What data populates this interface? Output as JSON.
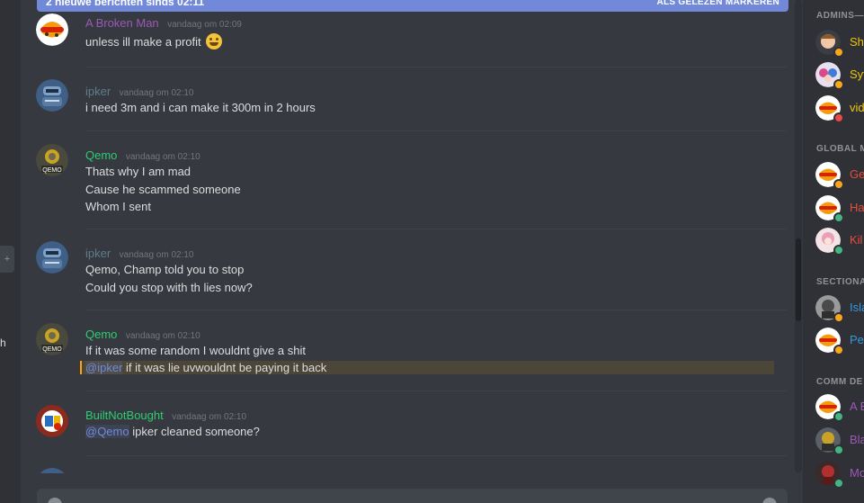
{
  "colors": {
    "chat_bg": "#36393f",
    "sidebar_bg": "#2f3136",
    "accent": "#7289da",
    "text": "#dcddde",
    "muted": "#72767d"
  },
  "banner": {
    "text": "2 nieuwe berichten sinds 02:11",
    "action": "ALS GELEZEN MARKEREN"
  },
  "left_strip": {
    "fragment": "h"
  },
  "messages": [
    {
      "author": "A Broken Man",
      "author_color": "#9b59b6",
      "timestamp": "vandaag om 02:09",
      "avatar_icon": "burger-king-logo",
      "lines": [
        "unless ill make a profit"
      ],
      "emoji": "grinning-face-emoji"
    },
    {
      "author": "ipker",
      "author_color": "#607d8b",
      "timestamp": "vandaag om 02:10",
      "avatar_icon": "robot-avatar",
      "lines": [
        "i need 3m and i can make it 300m in 2 hours"
      ]
    },
    {
      "author": "Qemo",
      "author_color": "#2ecc71",
      "timestamp": "vandaag om 02:10",
      "avatar_icon": "qemo-avatar",
      "avatar_text": "QEMO",
      "lines": [
        "Thats why I am mad",
        "Cause he scammed someone",
        "Whom I sent"
      ]
    },
    {
      "author": "ipker",
      "author_color": "#607d8b",
      "timestamp": "vandaag om 02:10",
      "avatar_icon": "robot-avatar",
      "lines": [
        "Qemo, Champ told you to stop",
        "Could you stop with th lies now?"
      ]
    },
    {
      "author": "Qemo",
      "author_color": "#2ecc71",
      "timestamp": "vandaag om 02:10",
      "avatar_icon": "qemo-avatar",
      "avatar_text": "QEMO",
      "lines": [
        "If it was some random I wouldnt give a shit"
      ],
      "mention_line": {
        "mention": "@ipker",
        "text": " if it was lie uvwouldnt be paying it back"
      }
    },
    {
      "author": "BuiltNotBought",
      "author_color": "#2ecc71",
      "timestamp": "vandaag om 02:10",
      "avatar_icon": "builtnotbought-avatar",
      "mention_line": {
        "mention": "@Qemo",
        "text": " ipker cleaned someone?"
      }
    }
  ],
  "members": {
    "roles": [
      {
        "name": "ADMINS—",
        "members": [
          {
            "name": "Shi",
            "color": "#f1c40f",
            "status": "#faa61a",
            "avatar_icon": "cartoon-face-avatar"
          },
          {
            "name": "Syt",
            "color": "#f1c40f",
            "status": "#faa61a",
            "avatar_icon": "anime-avatar"
          },
          {
            "name": "vid",
            "color": "#f1c40f",
            "status": "#f04747",
            "avatar_icon": "burger-king-logo"
          }
        ]
      },
      {
        "name": "GLOBAL M",
        "members": [
          {
            "name": "Ge",
            "color": "#e74c3c",
            "status": "#faa61a",
            "avatar_icon": "burger-king-logo"
          },
          {
            "name": "Ha",
            "color": "#e74c3c",
            "status": "#43b581",
            "avatar_icon": "burger-king-logo"
          },
          {
            "name": "Kil",
            "color": "#e74c3c",
            "status": "#43b581",
            "avatar_icon": "anime-avatar"
          }
        ]
      },
      {
        "name": "SECTIONA",
        "members": [
          {
            "name": "Isla",
            "color": "#3498db",
            "status": "#faa61a",
            "avatar_icon": "soldier-avatar"
          },
          {
            "name": "Per",
            "color": "#3498db",
            "status": "#faa61a",
            "avatar_icon": "burger-king-logo"
          }
        ]
      },
      {
        "name": "COMM DE",
        "members": [
          {
            "name": "A B",
            "color": "#9b59b6",
            "status": "#43b581",
            "avatar_icon": "burger-king-logo"
          },
          {
            "name": "Bla",
            "color": "#9b59b6",
            "status": "#43b581",
            "avatar_icon": "soldier-avatar"
          },
          {
            "name": "Mo",
            "color": "#9b59b6",
            "status": "#43b581",
            "avatar_icon": "character-avatar"
          }
        ]
      }
    ]
  }
}
